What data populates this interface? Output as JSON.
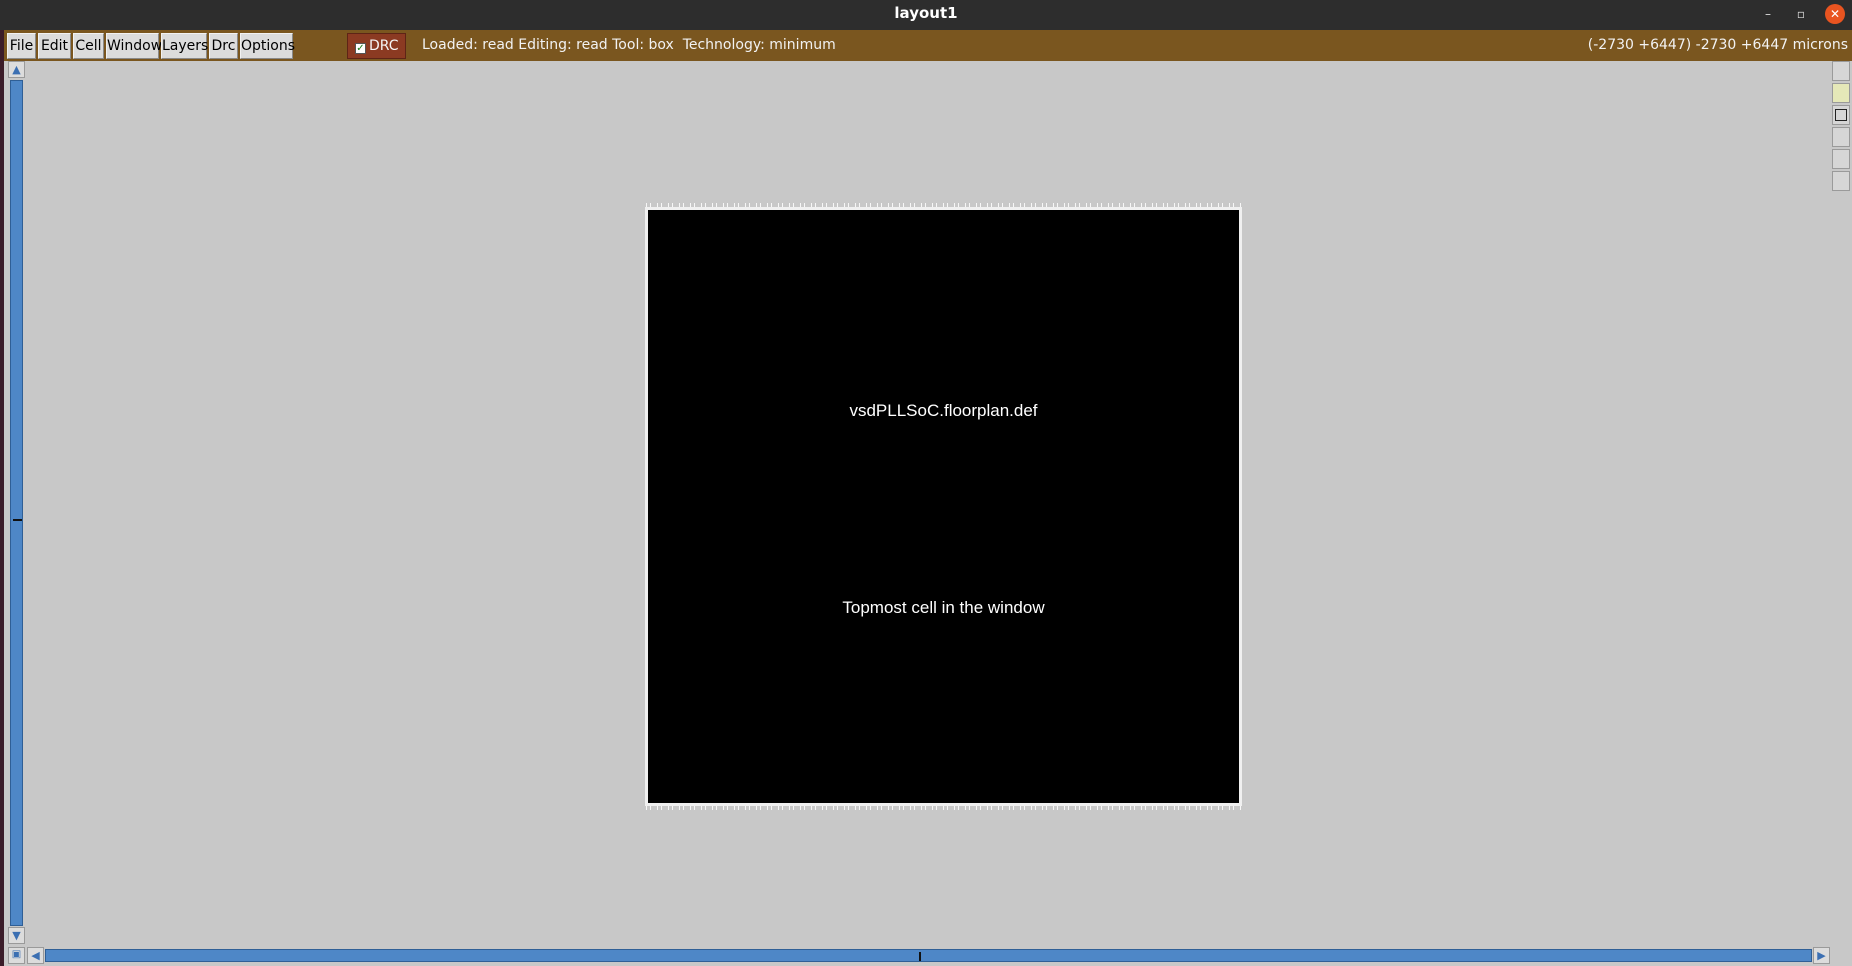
{
  "window": {
    "title": "layout1",
    "controls": {
      "minimize": "–",
      "maximize": "▫",
      "close": "✕"
    }
  },
  "menubar": {
    "items": [
      {
        "id": "file",
        "label": "File"
      },
      {
        "id": "edit",
        "label": "Edit"
      },
      {
        "id": "cell",
        "label": "Cell"
      },
      {
        "id": "window",
        "label": "Window"
      },
      {
        "id": "layers",
        "label": "Layers"
      },
      {
        "id": "drc",
        "label": "Drc"
      },
      {
        "id": "options",
        "label": "Options"
      }
    ],
    "drc_toggle": {
      "label": "DRC",
      "checked": true,
      "check_glyph": "✓"
    },
    "status": "Loaded: read Editing: read Tool: box  Technology: minimum",
    "coordinates": "(-2730 +6447) -2730 +6447 microns"
  },
  "scrollbars": {
    "up_icon": "▲",
    "down_icon": "▼",
    "left_icon": "◀",
    "right_icon": "▶",
    "corner_icon": "▣"
  },
  "layout": {
    "cell_name": "vsdPLLSoC.floorplan.def",
    "cell_note": "Topmost cell in the window"
  },
  "colors": {
    "menubar": "#7a561f",
    "drc": "#8b3a22",
    "scroll_track": "#4e87c7",
    "canvas": "#c8c8c8",
    "cell_fill": "#000000",
    "close_button": "#e95420"
  }
}
